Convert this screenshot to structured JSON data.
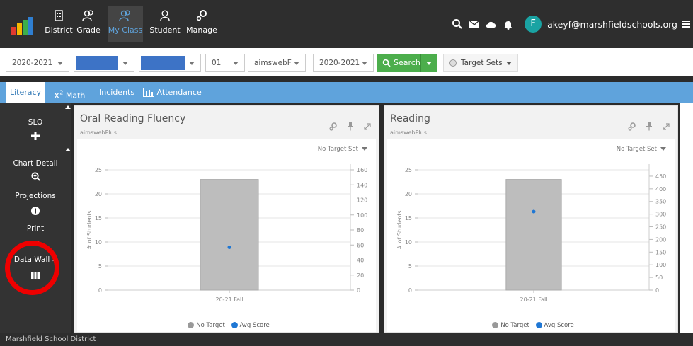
{
  "nav": {
    "items": [
      {
        "label": "District",
        "icon": "building-icon"
      },
      {
        "label": "Grade",
        "icon": "users-icon"
      },
      {
        "label": "My Class",
        "icon": "users-icon"
      },
      {
        "label": "Student",
        "icon": "user-icon"
      },
      {
        "label": "Manage",
        "icon": "gears-icon"
      }
    ],
    "active_index": 2,
    "avatar_letter": "F",
    "email": "akeyf@marshfieldschools.org",
    "accent": "#5fa3dc"
  },
  "filters": {
    "year1": "2020-2021",
    "grade": "01",
    "assessment": "aimswebF",
    "year2": "2020-2021",
    "search_label": "Search",
    "target_sets_label": "Target Sets"
  },
  "tabs": [
    {
      "label": "Literacy"
    },
    {
      "label": "Math",
      "icon": "x2-icon"
    },
    {
      "label": "Incidents"
    },
    {
      "label": "Attendance",
      "icon": "bar-chart-icon"
    }
  ],
  "rail": {
    "slo": "SLO",
    "chart_detail": "Chart Detail",
    "projections": "Projections",
    "print": "Print",
    "data_wall": "Data Wall »"
  },
  "panels": [
    {
      "title": "Oral Reading Fluency",
      "subtitle": "aimswebPlus",
      "target": "No Target Set"
    },
    {
      "title": "Reading",
      "subtitle": "aimswebPlus",
      "target": "No Target Set"
    }
  ],
  "legend": {
    "no_target": "No Target",
    "avg_score": "Avg Score"
  },
  "footer": "Marshfield School District",
  "chart_data": [
    {
      "type": "bar",
      "categories": [
        "20-21 Fall"
      ],
      "ylabel": "# of Students",
      "ylim": [
        0,
        25
      ],
      "yticks": [
        0,
        5,
        10,
        15,
        20,
        25
      ],
      "y2lim": [
        0,
        160
      ],
      "y2ticks": [
        0,
        20,
        40,
        60,
        80,
        100,
        120,
        140,
        160
      ],
      "series": [
        {
          "name": "No Target",
          "axis": "left",
          "values": [
            23
          ],
          "color": "#bdbdbd"
        },
        {
          "name": "Avg Score",
          "axis": "right",
          "values": [
            57
          ],
          "color": "#1f77d4"
        }
      ]
    },
    {
      "type": "bar",
      "categories": [
        "20-21 Fall"
      ],
      "ylabel": "# of Students",
      "ylim": [
        0,
        25
      ],
      "yticks": [
        0,
        5,
        10,
        15,
        20,
        25
      ],
      "y2lim": [
        0,
        475
      ],
      "y2ticks": [
        0,
        50,
        100,
        150,
        200,
        250,
        300,
        350,
        400,
        450
      ],
      "series": [
        {
          "name": "No Target",
          "axis": "left",
          "values": [
            23
          ],
          "color": "#bdbdbd"
        },
        {
          "name": "Avg Score",
          "axis": "right",
          "values": [
            310
          ],
          "color": "#1f77d4"
        }
      ]
    }
  ]
}
